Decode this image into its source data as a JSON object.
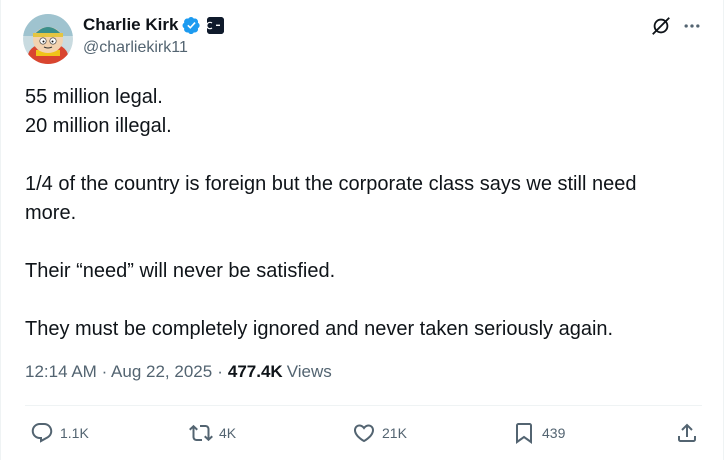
{
  "author": {
    "name": "Charlie Kirk",
    "handle": "@charliekirk11",
    "verified": true,
    "verified_color": "#1d9bf0"
  },
  "tweet": {
    "lines": [
      "55 million legal.",
      "20 million illegal.",
      "",
      "1/4 of the country is foreign but the corporate class says we still need more.",
      "",
      "Their “need” will never be satisfied.",
      "",
      "They must be completely ignored and never taken seriously again."
    ]
  },
  "meta": {
    "time": "12:14 AM",
    "separator": "·",
    "date": "Aug 22, 2025",
    "views_count": "477.4K",
    "views_label": "Views"
  },
  "actions": {
    "replies": "1.1K",
    "reposts": "4K",
    "likes": "21K",
    "bookmarks": "439"
  },
  "icons": {
    "header": [
      "grok-icon",
      "more-icon"
    ],
    "actions": [
      "reply-icon",
      "repost-icon",
      "like-icon",
      "bookmark-icon",
      "share-icon"
    ]
  },
  "colors": {
    "text": "#0f1419",
    "secondary": "#536471",
    "divider": "#eff3f4",
    "brand_blue": "#1d9bf0"
  }
}
